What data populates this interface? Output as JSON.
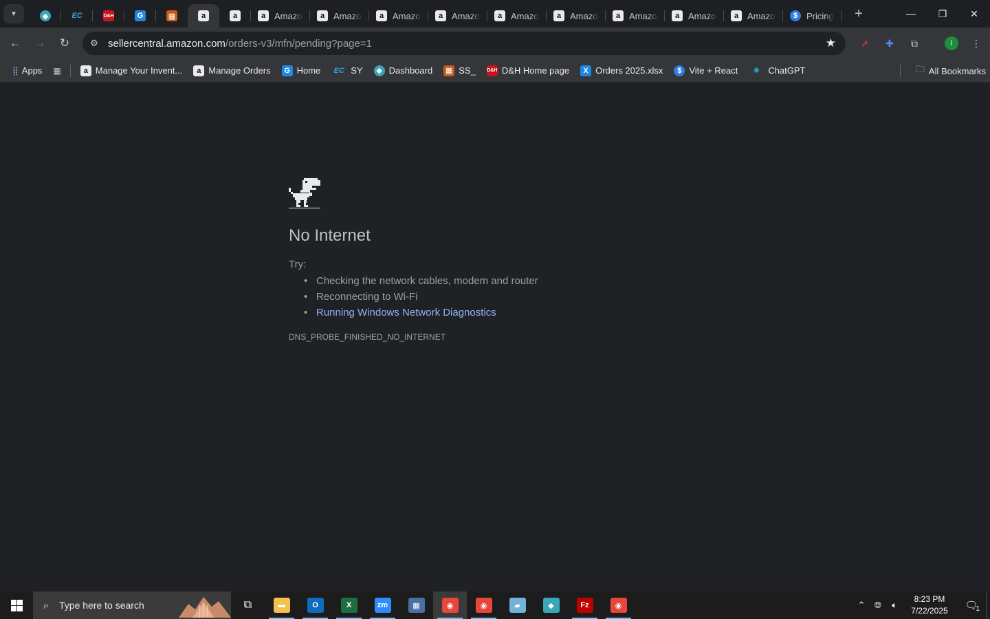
{
  "tabs": {
    "pinned": [
      {
        "icon": "teal-app-icon",
        "glyph": "◆"
      },
      {
        "icon": "ec-logo-icon",
        "glyph": "EC"
      },
      {
        "icon": "dh-logo-icon",
        "glyph": "D&H"
      },
      {
        "icon": "blue-g-icon",
        "glyph": "G"
      },
      {
        "icon": "orange-box-icon",
        "glyph": "▦"
      },
      {
        "icon": "amazon-icon",
        "glyph": "a"
      },
      {
        "icon": "amazon-icon",
        "glyph": "a"
      }
    ],
    "titled": [
      {
        "title": "Amazon",
        "icon": "amazon-icon",
        "glyph": "a"
      },
      {
        "title": "Amazon",
        "icon": "amazon-icon",
        "glyph": "a"
      },
      {
        "title": "Amazon",
        "icon": "amazon-icon",
        "glyph": "a"
      },
      {
        "title": "Amazon",
        "icon": "amazon-icon",
        "glyph": "a"
      },
      {
        "title": "Amazon",
        "icon": "amazon-icon",
        "glyph": "a"
      },
      {
        "title": "Amazon",
        "icon": "amazon-icon",
        "glyph": "a"
      },
      {
        "title": "Amazon",
        "icon": "amazon-icon",
        "glyph": "a"
      },
      {
        "title": "Amazon",
        "icon": "amazon-icon",
        "glyph": "a"
      },
      {
        "title": "Amazon",
        "icon": "amazon-icon",
        "glyph": "a"
      },
      {
        "title": "Pricing",
        "icon": "pricing-icon",
        "glyph": "$"
      }
    ],
    "new_tab": "+"
  },
  "toolbar": {
    "url_host": "sellercentral.amazon.com",
    "url_path": "/orders-v3/mfn/pending?page=1"
  },
  "bookmarks": {
    "apps_label": "Apps",
    "items": [
      {
        "label": "Manage Your Invent...",
        "icon": "amazon-icon",
        "glyph": "a"
      },
      {
        "label": "Manage Orders",
        "icon": "amazon-icon",
        "glyph": "a"
      },
      {
        "label": "Home",
        "icon": "blue-g-icon",
        "glyph": "G"
      },
      {
        "label": "SY",
        "icon": "ec-logo-icon",
        "glyph": "EC"
      },
      {
        "label": "Dashboard",
        "icon": "teal-app-icon",
        "glyph": "◆"
      },
      {
        "label": "SS_",
        "icon": "orange-box-icon",
        "glyph": "▦"
      },
      {
        "label": "D&H Home page",
        "icon": "dh-logo-icon",
        "glyph": "D&H"
      },
      {
        "label": "Orders 2025.xlsx",
        "icon": "excel-icon",
        "glyph": "X"
      },
      {
        "label": "Vite + React",
        "icon": "pricing-icon",
        "glyph": "$"
      },
      {
        "label": "ChatGPT",
        "icon": "chatgpt-icon",
        "glyph": "✺"
      }
    ],
    "all_bookmarks": "All Bookmarks"
  },
  "error_page": {
    "heading": "No Internet",
    "try_label": "Try:",
    "suggestions": [
      "Checking the network cables, modem and router",
      "Reconnecting to Wi-Fi",
      "Running Windows Network Diagnostics"
    ],
    "error_code": "DNS_PROBE_FINISHED_NO_INTERNET"
  },
  "taskbar": {
    "search_placeholder": "Type here to search",
    "apps": [
      {
        "name": "file-explorer",
        "color": "#f2c14e",
        "glyph": "▬"
      },
      {
        "name": "outlook",
        "color": "#0f6cbd",
        "glyph": "O"
      },
      {
        "name": "excel",
        "color": "#1d6f42",
        "glyph": "X"
      },
      {
        "name": "zoom",
        "color": "#2d8cff",
        "glyph": "zm"
      },
      {
        "name": "calculator",
        "color": "#4a6fa5",
        "glyph": "▦"
      },
      {
        "name": "chrome",
        "color": "#e8453c",
        "glyph": "◉"
      },
      {
        "name": "chrome-profile",
        "color": "#e8453c",
        "glyph": "◉"
      },
      {
        "name": "notepad-app",
        "color": "#6fb3d8",
        "glyph": "▰"
      },
      {
        "name": "teal-app",
        "color": "#3aa7b8",
        "glyph": "◆"
      },
      {
        "name": "filezilla",
        "color": "#bf0000",
        "glyph": "Fz"
      },
      {
        "name": "chrome-other",
        "color": "#e8453c",
        "glyph": "◉"
      }
    ],
    "time": "8:23 PM",
    "date": "7/22/2025",
    "notification_count": "1"
  }
}
